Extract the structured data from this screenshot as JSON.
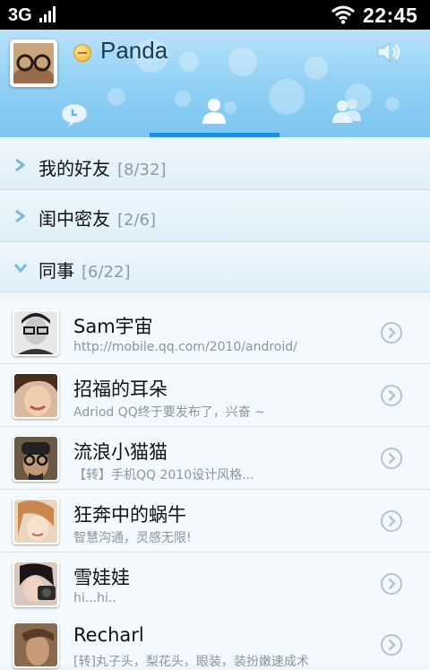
{
  "status_bar": {
    "network": "3G",
    "time": "22:45"
  },
  "header": {
    "nickname": "Panda",
    "tabs": [
      {
        "name": "recent",
        "icon": "chat-bubble-icon"
      },
      {
        "name": "contacts",
        "icon": "person-icon",
        "active": true
      },
      {
        "name": "groups",
        "icon": "people-icon"
      }
    ],
    "accent": "#1d8fdc"
  },
  "groups": [
    {
      "name": "我的好友",
      "count": "[8/32]",
      "expanded": false
    },
    {
      "name": "闺中密友",
      "count": "[2/6]",
      "expanded": false
    },
    {
      "name": "同事",
      "count": "[6/22]",
      "expanded": true
    }
  ],
  "contacts": [
    {
      "name": "Sam宇宙",
      "signature": "http://mobile.qq.com/2010/android/"
    },
    {
      "name": "招福的耳朵",
      "signature": "Adriod QQ终于要发布了，兴奋 ~"
    },
    {
      "name": "流浪小猫猫",
      "signature": "【转】手机QQ 2010设计风格..."
    },
    {
      "name": "狂奔中的蜗牛",
      "signature": "智慧沟通，灵感无限!"
    },
    {
      "name": "雪娃娃",
      "signature": "hi...hi.."
    },
    {
      "name": "Recharl",
      "signature": "[转]丸子头，梨花头，眼装，装扮嫩速成术"
    }
  ]
}
